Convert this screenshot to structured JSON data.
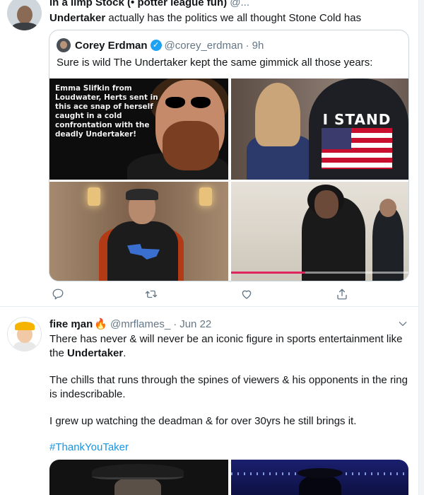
{
  "tweet1": {
    "header_name": "in a ilmp Stock (• potter league fun)",
    "header_handle": "@...",
    "text_bold": "Undertaker",
    "text_rest": " actually has the politics we all thought Stone Cold has",
    "quote": {
      "name": "Corey Erdman",
      "verified_glyph": "✓",
      "handle": "@corey_erdman",
      "separator": "·",
      "time": "9h",
      "text": "Sure is wild The Undertaker kept the same gimmick all those years:",
      "images": [
        {
          "alt": "Emma Slifkin photo",
          "caption": "Emma Slifkin from Loudwater, Herts sent in this ace snap of herself caught in a cold confrontation with the deadly Undertaker!"
        },
        {
          "alt": "I Stand hoodie photo",
          "shirt_text": "I STAND"
        },
        {
          "alt": "Undertaker in armchair photo"
        },
        {
          "alt": "Undertaker video still",
          "progress": 0.42
        }
      ]
    },
    "actions": [
      {
        "name": "reply",
        "icon": "reply-icon"
      },
      {
        "name": "retweet",
        "icon": "retweet-icon"
      },
      {
        "name": "like",
        "icon": "heart-icon"
      },
      {
        "name": "share",
        "icon": "share-icon"
      }
    ]
  },
  "tweet2": {
    "name": "fiʀe ɱan",
    "emoji": "🔥",
    "handle": "@mrflames_",
    "separator": "·",
    "date": "Jun 22",
    "p1_start": "There has never & will never be an iconic figure in sports entertainment like the ",
    "p1_bold": "Undertaker",
    "p1_end": ".",
    "p2": "The chills that runs through the spines of viewers & his opponents in the ring is indescribable.",
    "p3": "I grew up watching the deadman & for over 30yrs he still brings it.",
    "hashtag": "#ThankYouTaker"
  },
  "colors": {
    "link": "#1b95e0",
    "muted": "#657786",
    "verified": "#1da1f2",
    "border": "#ccd6dd"
  }
}
